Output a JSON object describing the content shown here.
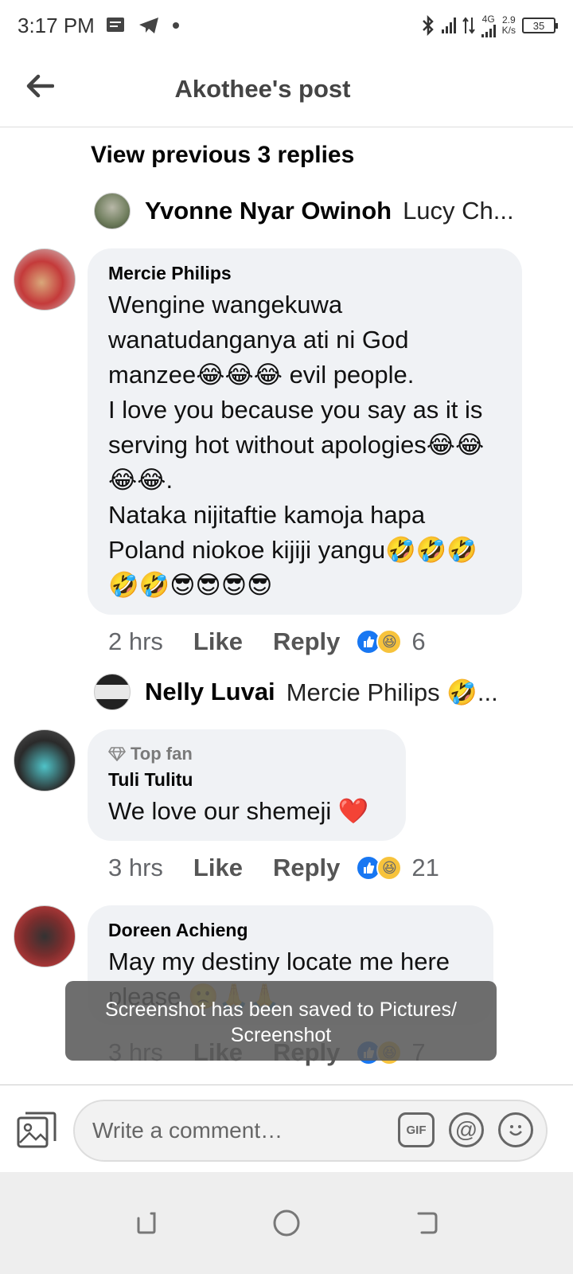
{
  "status_bar": {
    "time": "3:17 PM",
    "network": "4G",
    "speed_value": "2.9",
    "speed_unit": "K/s",
    "battery": "35"
  },
  "header": {
    "title": "Akothee's post"
  },
  "thread": {
    "view_previous": "View previous 3 replies",
    "reply_preview_1": {
      "name": "Yvonne Nyar Owinoh",
      "text": "Lucy Ch..."
    },
    "reply_preview_2": {
      "name": "Nelly Luvai",
      "text": "Mercie Philips 🤣..."
    }
  },
  "comments": [
    {
      "name": "Mercie Philips",
      "text": "Wengine wangekuwa wanatudanganya ati ni God manzee😂😂😂 evil people.\nI love you because you say as it is serving hot without apologies😂😂😂😂.\nNataka nijitaftie kamoja hapa Poland niokoe kijiji yangu🤣🤣🤣🤣🤣😎😎😎😎",
      "time": "2 hrs",
      "like": "Like",
      "reply": "Reply",
      "reactions": "6"
    },
    {
      "badge": "Top fan",
      "name": "Tuli Tulitu",
      "text": "We love our shemeji ❤️",
      "time": "3 hrs",
      "like": "Like",
      "reply": "Reply",
      "reactions": "21"
    },
    {
      "name": "Doreen Achieng",
      "text": "May my destiny locate me here please 🙁🙏🙏",
      "time": "3 hrs",
      "like": "Like",
      "reply": "Reply",
      "reactions": "7"
    }
  ],
  "toast": {
    "line1": "Screenshot has been saved to  Pictures/",
    "line2": "Screenshot"
  },
  "composer": {
    "placeholder": "Write a comment…",
    "gif_label": "GIF"
  },
  "colors": {
    "like_blue": "#1877f2",
    "bubble_bg": "#f0f2f5",
    "haha_yellow": "#f7c33c"
  },
  "icons": [
    "back-arrow-icon",
    "photo-icon",
    "gif-icon",
    "mention-icon",
    "emoji-icon",
    "heart-icon",
    "diamond-icon"
  ]
}
